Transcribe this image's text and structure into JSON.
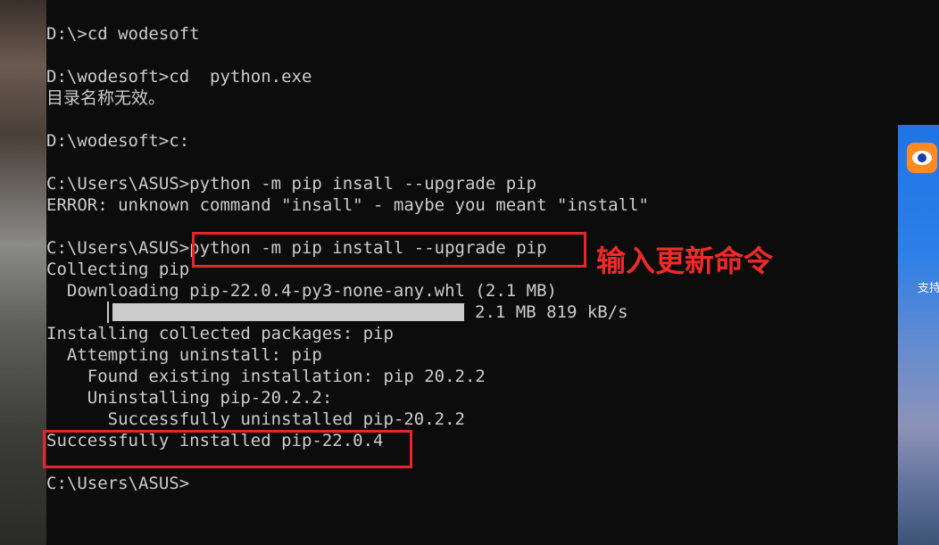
{
  "terminal": {
    "lines": [
      "D:\\>cd wodesoft",
      "D:\\wodesoft>cd  python.exe",
      "目录名称无效。",
      "D:\\wodesoft>c:",
      "C:\\Users\\ASUS>python -m pip insall --upgrade pip",
      "ERROR: unknown command \"insall\" - maybe you meant \"install\"",
      "C:\\Users\\ASUS>python -m pip install --upgrade pip",
      "Collecting pip",
      "  Downloading pip-22.0.4-py3-none-any.whl (2.1 MB)",
      "Installing collected packages: pip",
      "  Attempting uninstall: pip",
      "    Found existing installation: pip 20.2.2",
      "    Uninstalling pip-20.2.2:",
      "      Successfully uninstalled pip-20.2.2",
      "Successfully installed pip-22.0.4",
      "C:\\Users\\ASUS>"
    ],
    "progress_text": "2.1 MB 819 kB/s",
    "progress_fraction": 1.0
  },
  "annotation": {
    "label": "输入更新命令",
    "color": "#e5262a"
  },
  "side_panel": {
    "text": "支持",
    "icon": "eye-app-icon"
  }
}
